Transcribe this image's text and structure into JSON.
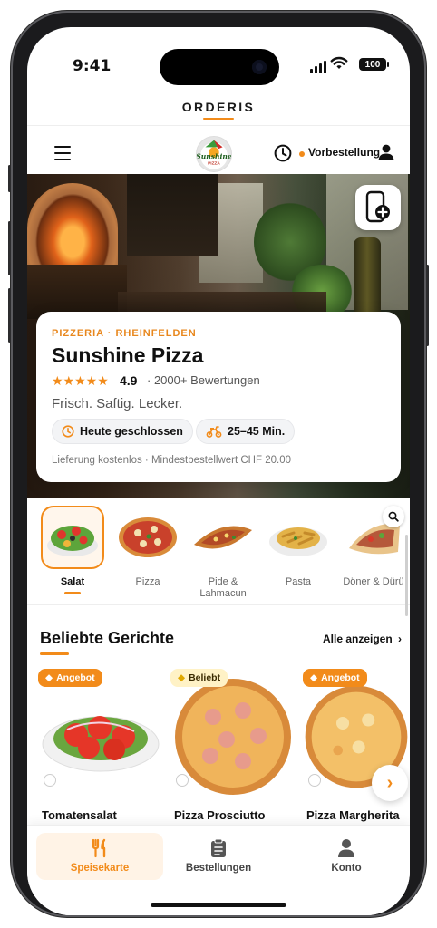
{
  "status_bar": {
    "time": "9:41",
    "battery": "100"
  },
  "brand": {
    "name": "ORDERIS"
  },
  "header": {
    "logo_text": "Sunshine PIZZA",
    "preorder_label": "Vorbestellung"
  },
  "restaurant": {
    "category": "PIZZERIA · RHEINFELDEN",
    "name": "Sunshine Pizza",
    "stars": "★★★★★",
    "rating": "4.9",
    "reviews": "· 2000+ Bewertungen",
    "tagline": "Frisch. Saftig. Lecker.",
    "status": "Heute geschlossen",
    "delivery_time": "25–45 Min.",
    "delivery_info": "Lieferung kostenlos · Mindestbestellwert CHF 20.00"
  },
  "categories": [
    {
      "label": "Salat",
      "active": true
    },
    {
      "label": "Pizza",
      "active": false
    },
    {
      "label": "Pide & Lahmacun",
      "active": false
    },
    {
      "label": "Pasta",
      "active": false
    },
    {
      "label": "Döner & Dürü",
      "active": false
    }
  ],
  "popular": {
    "title": "Beliebte Gerichte",
    "see_all": "Alle anzeigen",
    "items": [
      {
        "name": "Tomatensalat",
        "badge": "Angebot"
      },
      {
        "name": "Pizza Prosciutto",
        "badge": "Beliebt"
      },
      {
        "name": "Pizza Margherita",
        "badge": "Angebot"
      }
    ]
  },
  "tabbar": {
    "tabs": [
      {
        "label": "Speisekarte",
        "icon": "cutlery-icon",
        "active": true
      },
      {
        "label": "Bestellungen",
        "icon": "clipboard-icon",
        "active": false
      },
      {
        "label": "Konto",
        "icon": "person-icon",
        "active": false
      }
    ]
  },
  "colors": {
    "accent": "#f28b1a",
    "text": "#111111",
    "muted": "#777777"
  }
}
